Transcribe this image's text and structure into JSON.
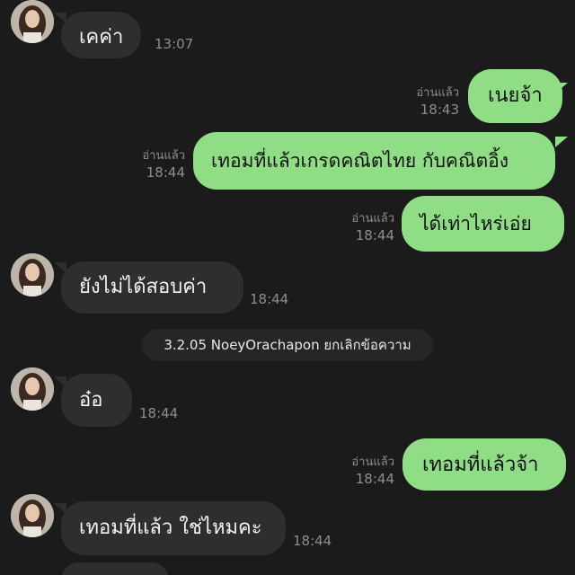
{
  "colors": {
    "background": "#1b1b1b",
    "incoming_bubble": "#2e2e2e",
    "outgoing_bubble": "#8fdd85",
    "meta_text": "#8e8e8e"
  },
  "messages": [
    {
      "direction": "in",
      "text": "เคค่า",
      "time": "13:07",
      "avatar": "contact-avatar"
    },
    {
      "direction": "out",
      "text": "เนยจ้า",
      "read": "อ่านแล้ว",
      "time": "18:43"
    },
    {
      "direction": "out",
      "text": "เทอมที่แล้วเกรดคณิตไทย กับคณิตอิ้ง",
      "read": "อ่านแล้ว",
      "time": "18:44"
    },
    {
      "direction": "out",
      "text": "ได้เท่าไหร่เอ่ย",
      "read": "อ่านแล้ว",
      "time": "18:44"
    },
    {
      "direction": "in",
      "text": "ยังไม่ได้สอบค่า",
      "time": "18:44",
      "avatar": "contact-avatar"
    },
    {
      "direction": "in",
      "text": "อ๋อ",
      "time": "18:44",
      "avatar": "contact-avatar"
    },
    {
      "direction": "out",
      "text": "เทอมที่แล้วจ้า",
      "read": "อ่านแล้ว",
      "time": "18:44"
    },
    {
      "direction": "in",
      "text": "เทอมที่แล้ว ใช่ไหมคะ",
      "time": "18:44",
      "avatar": "contact-avatar"
    }
  ],
  "system_notice": "3.2.05 NoeyOrachapon ยกเลิกข้อความ"
}
